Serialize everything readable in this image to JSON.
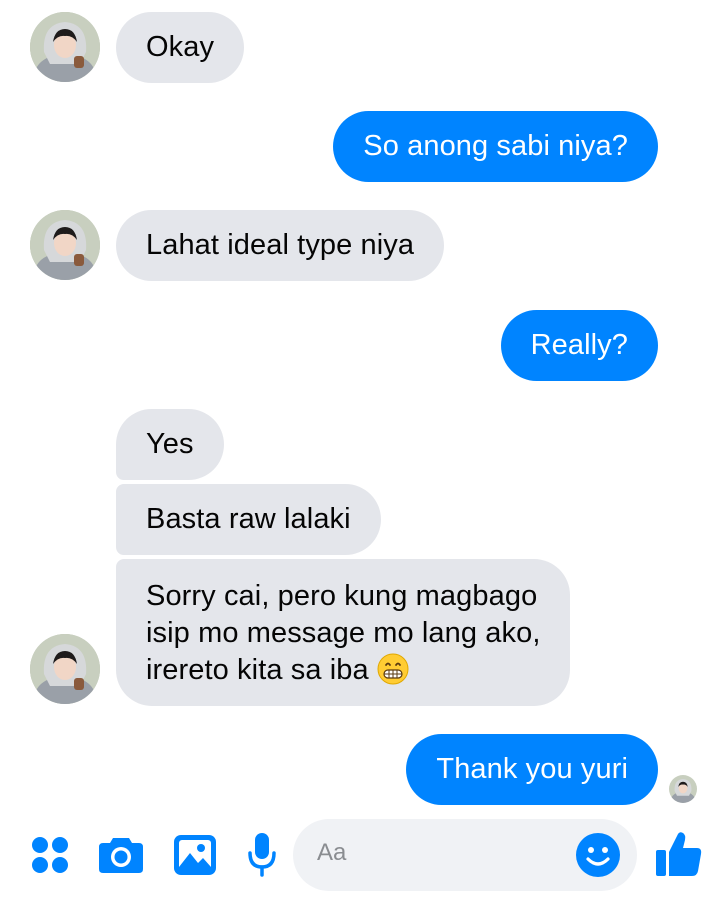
{
  "conversation": {
    "messages": [
      {
        "sender": "other",
        "text": "Okay"
      },
      {
        "sender": "me",
        "text": "So anong sabi niya?"
      },
      {
        "sender": "other",
        "text": "Lahat ideal type niya"
      },
      {
        "sender": "me",
        "text": "Really?"
      },
      {
        "sender": "other",
        "text": "Yes"
      },
      {
        "sender": "other",
        "text": "Basta raw lalaki"
      },
      {
        "sender": "other",
        "lines": [
          "Sorry cai, pero kung magbago",
          "isip mo message mo lang ako,",
          "irereto kita sa iba"
        ],
        "emoji": "grinning-face-emoji"
      },
      {
        "sender": "me",
        "text": "Thank you yuri"
      }
    ]
  },
  "composer": {
    "placeholder": "Aa",
    "icons": [
      "more-dots-icon",
      "camera-icon",
      "gallery-icon",
      "microphone-icon",
      "emoji-icon",
      "thumbs-up-icon"
    ]
  },
  "colors": {
    "accent": "#0084ff",
    "incoming_bubble": "#e4e6eb",
    "input_background": "#f0f2f5"
  }
}
